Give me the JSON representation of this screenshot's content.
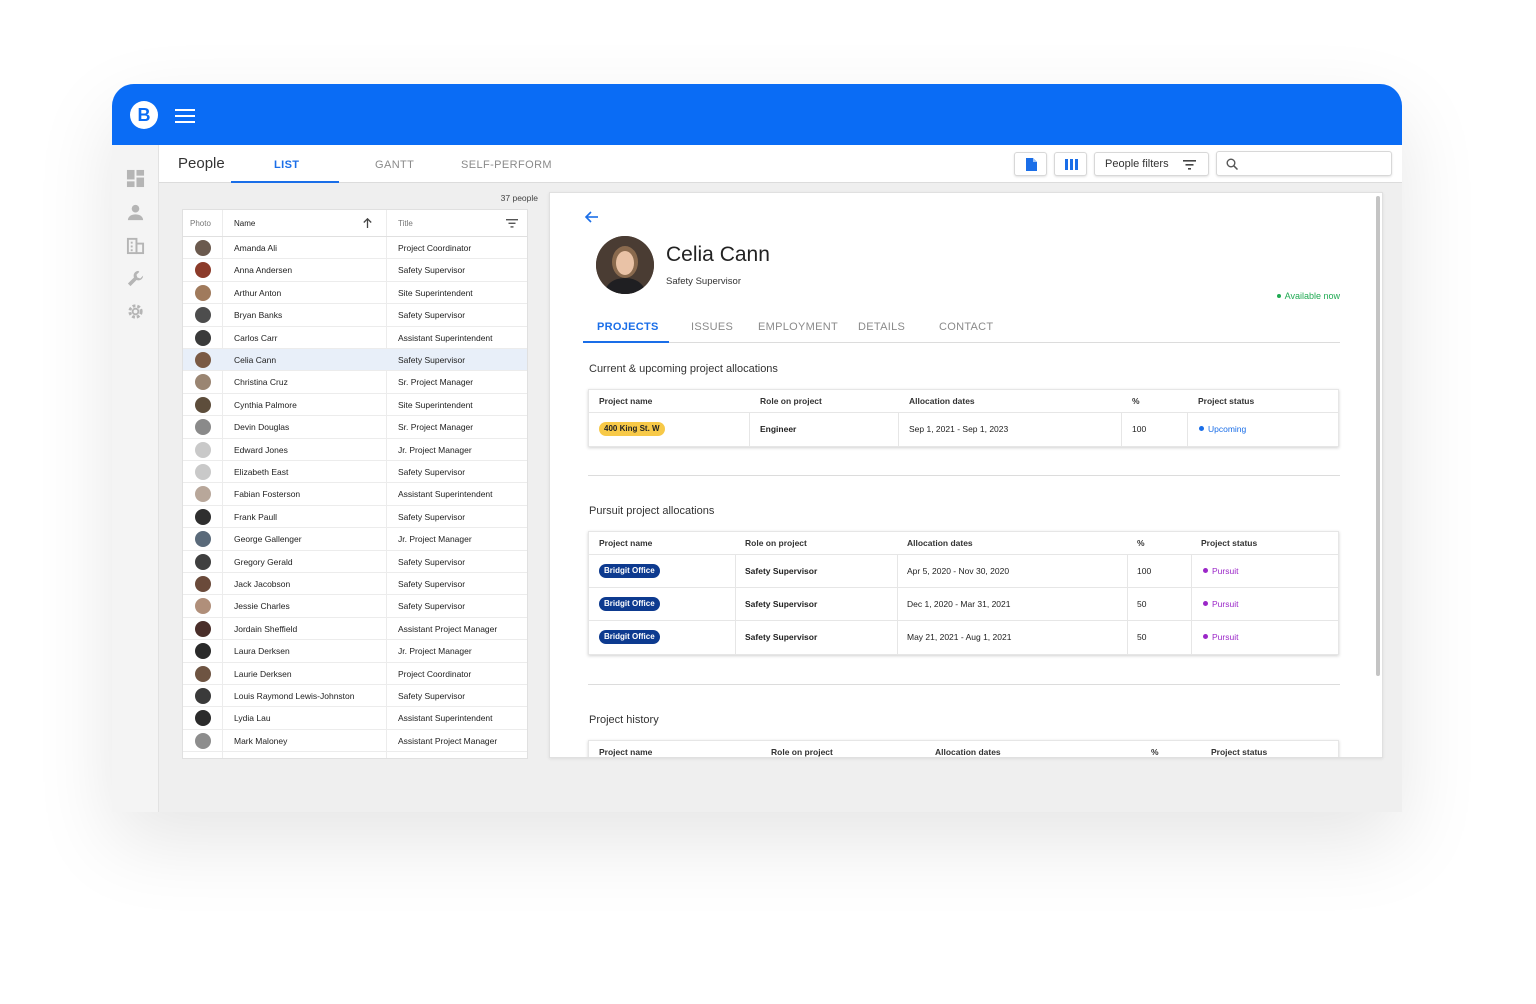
{
  "app": {
    "logo_letter": "B"
  },
  "header": {
    "title": "People",
    "tabs": [
      {
        "label": "LIST",
        "active": true
      },
      {
        "label": "GANTT",
        "active": false
      },
      {
        "label": "SELF-PERFORM",
        "active": false
      }
    ],
    "filters_label": "People filters",
    "search": {
      "placeholder": ""
    }
  },
  "sidebar": {
    "icons": [
      "dashboard-icon",
      "person-icon",
      "building-icon",
      "wrench-icon",
      "gear-icon"
    ]
  },
  "people_list": {
    "count": "37 people",
    "columns": {
      "photo": "Photo",
      "name": "Name",
      "title": "Title"
    },
    "rows": [
      {
        "name": "Amanda Ali",
        "title": "Project Coordinator"
      },
      {
        "name": "Anna Andersen",
        "title": "Safety Supervisor"
      },
      {
        "name": "Arthur Anton",
        "title": "Site Superintendent"
      },
      {
        "name": "Bryan Banks",
        "title": "Safety Supervisor"
      },
      {
        "name": "Carlos Carr",
        "title": "Assistant Superintendent"
      },
      {
        "name": "Celia Cann",
        "title": "Safety Supervisor",
        "selected": true
      },
      {
        "name": "Christina Cruz",
        "title": "Sr. Project Manager"
      },
      {
        "name": "Cynthia Palmore",
        "title": "Site Superintendent"
      },
      {
        "name": "Devin Douglas",
        "title": "Sr. Project Manager"
      },
      {
        "name": "Edward Jones",
        "title": "Jr. Project Manager"
      },
      {
        "name": "Elizabeth East",
        "title": "Safety Supervisor"
      },
      {
        "name": "Fabian Fosterson",
        "title": "Assistant Superintendent"
      },
      {
        "name": "Frank Paull",
        "title": "Safety Supervisor"
      },
      {
        "name": "George Gallenger",
        "title": "Jr. Project Manager"
      },
      {
        "name": "Gregory Gerald",
        "title": "Safety Supervisor"
      },
      {
        "name": "Jack Jacobson",
        "title": "Safety Supervisor"
      },
      {
        "name": "Jessie Charles",
        "title": "Safety Supervisor"
      },
      {
        "name": "Jordain Sheffield",
        "title": "Assistant Project Manager"
      },
      {
        "name": "Laura Derksen",
        "title": "Jr. Project Manager"
      },
      {
        "name": "Laurie Derksen",
        "title": "Project Coordinator"
      },
      {
        "name": "Louis Raymond Lewis-Johnston",
        "title": "Safety Supervisor"
      },
      {
        "name": "Lydia Lau",
        "title": "Assistant Superintendent"
      },
      {
        "name": "Mark Maloney",
        "title": "Assistant Project Manager"
      }
    ]
  },
  "profile": {
    "name": "Celia Cann",
    "title": "Safety Supervisor",
    "availability": "Available now",
    "tabs": [
      "PROJECTS",
      "ISSUES",
      "EMPLOYMENT",
      "DETAILS",
      "CONTACT"
    ],
    "columns": {
      "project": "Project name",
      "role": "Role on project",
      "dates": "Allocation dates",
      "percent": "%",
      "status": "Project status"
    },
    "current": {
      "heading": "Current & upcoming project allocations",
      "rows": [
        {
          "project": "400 King St. W",
          "role": "Engineer",
          "dates": "Sep 1, 2021 - Sep 1, 2023",
          "percent": "100",
          "status": "Upcoming"
        }
      ]
    },
    "pursuit": {
      "heading": "Pursuit project allocations",
      "rows": [
        {
          "project": "Bridgit Office",
          "role": "Safety Supervisor",
          "dates": "Apr 5, 2020 - Nov 30, 2020",
          "percent": "100",
          "status": "Pursuit"
        },
        {
          "project": "Bridgit Office",
          "role": "Safety Supervisor",
          "dates": "Dec 1, 2020 - Mar 31, 2021",
          "percent": "50",
          "status": "Pursuit"
        },
        {
          "project": "Bridgit Office",
          "role": "Safety Supervisor",
          "dates": "May 21, 2021 - Aug 1, 2021",
          "percent": "50",
          "status": "Pursuit"
        }
      ]
    },
    "history": {
      "heading": "Project history"
    }
  },
  "colors": {
    "brand": "#0a6cf5",
    "accent": "#1a6ee8",
    "available": "#1faa52",
    "upcoming": "#1a6ee8",
    "pursuit": "#9b27c8",
    "yellow_chip": "#f7c948",
    "navy_chip": "#0d3a8f"
  }
}
